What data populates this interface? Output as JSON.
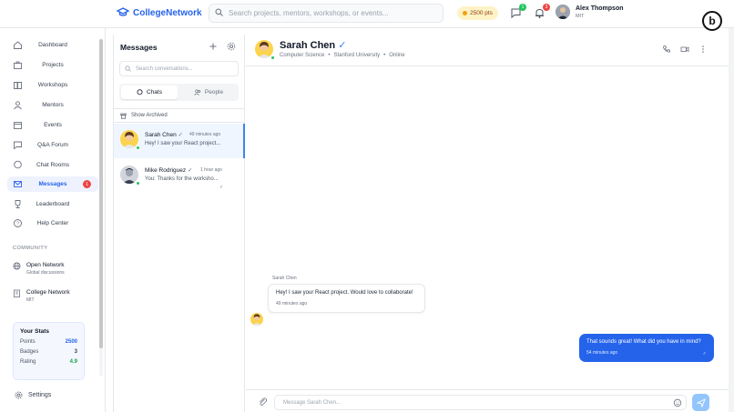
{
  "app": {
    "name": "CollegeNetwork",
    "brand_color": "#2563eb"
  },
  "topbar": {
    "search_placeholder": "Search projects, mentors, workshops, or events...",
    "points": "2500 pts",
    "messages_count": "1",
    "notifications_count": "3",
    "user_name": "Alex Thompson",
    "user_school": "MIT"
  },
  "sidebar": {
    "items": [
      {
        "label": "Dashboard",
        "icon": "home-icon"
      },
      {
        "label": "Projects",
        "icon": "briefcase-icon"
      },
      {
        "label": "Workshops",
        "icon": "book-icon"
      },
      {
        "label": "Mentors",
        "icon": "user-icon"
      },
      {
        "label": "Events",
        "icon": "calendar-icon"
      },
      {
        "label": "Q&A Forum",
        "icon": "chat-icon"
      },
      {
        "label": "Chat Rooms",
        "icon": "chat-bubble-icon"
      },
      {
        "label": "Messages",
        "icon": "mail-icon",
        "badge": "1"
      },
      {
        "label": "Leaderboard",
        "icon": "trophy-icon"
      },
      {
        "label": "Help Center",
        "icon": "help-icon"
      }
    ],
    "community_heading": "COMMUNITY",
    "community": [
      {
        "title": "Open Network",
        "subtitle": "Global discussions",
        "icon": "globe-icon"
      },
      {
        "title": "College Network",
        "subtitle": "MIT",
        "icon": "building-icon"
      }
    ],
    "stats": {
      "title": "Your Stats",
      "rows": [
        {
          "label": "Points",
          "value": "2500",
          "color": "#2563eb"
        },
        {
          "label": "Badges",
          "value": "3",
          "color": "#374151"
        },
        {
          "label": "Rating",
          "value": "4.9",
          "color": "#16a34a"
        }
      ]
    },
    "settings_label": "Settings"
  },
  "messages_panel": {
    "title": "Messages",
    "search_placeholder": "Search conversations...",
    "tabs": [
      {
        "label": "Chats"
      },
      {
        "label": "People"
      }
    ],
    "archived_label": "Show Archived",
    "conversations": [
      {
        "name": "Sarah Chen",
        "time": "49 minutes ago",
        "preview": "Hey! I saw your React project...",
        "online": true
      },
      {
        "name": "Mike Rodriguez",
        "time": "1 hour ago",
        "preview": "You: Thanks for the worksho...",
        "online": true
      }
    ]
  },
  "chat": {
    "name": "Sarah Chen",
    "major": "Computer Science",
    "university": "Stanford University",
    "status": "Online",
    "incoming": {
      "sender": "Sarah Chen",
      "text": "Hey! I saw your React project. Would love to collaborate!",
      "time": "49 minutes ago"
    },
    "outgoing": {
      "text": "That sounds great! What did you have in mind?",
      "time": "54 minutes ago"
    },
    "input_placeholder": "Message Sarah Chen..."
  }
}
